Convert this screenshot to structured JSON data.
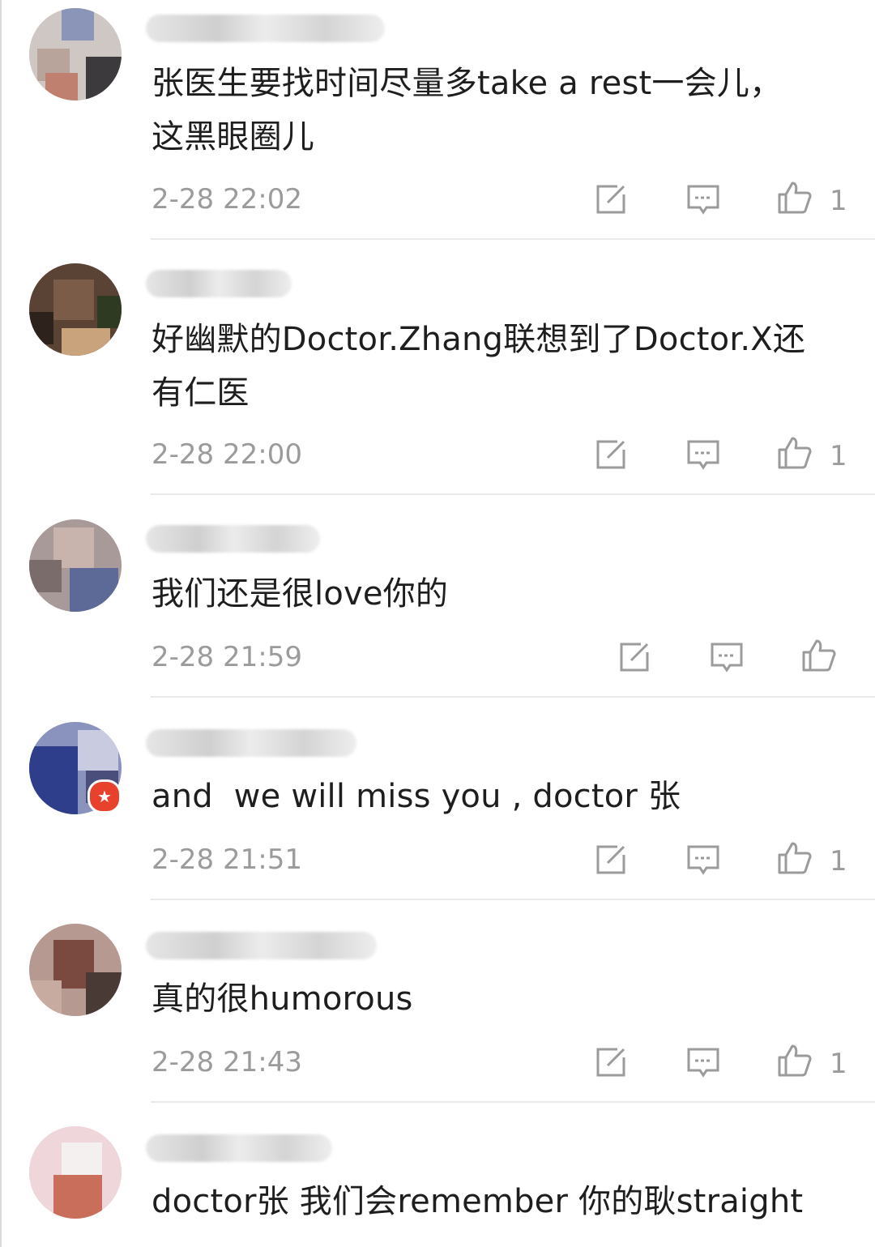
{
  "comments": [
    {
      "text": "张医生要找时间尽量多take a rest一会儿，\n这黑眼圈儿",
      "time": "2-28 22:02",
      "likes": "1"
    },
    {
      "text": "好幽默的Doctor.Zhang联想到了Doctor.X还\n有仁医",
      "time": "2-28 22:00",
      "likes": "1"
    },
    {
      "text": "我们还是很love你的",
      "time": "2-28 21:59",
      "likes": ""
    },
    {
      "text": "and  we will miss you , doctor 张",
      "time": "2-28 21:51",
      "likes": "1",
      "badge_icon": "star-badge-icon"
    },
    {
      "text": "真的很humorous",
      "time": "2-28 21:43",
      "likes": "1"
    },
    {
      "text": "doctor张 我们会remember 你的耿straight",
      "time": "",
      "likes": ""
    }
  ],
  "icons": {
    "share": "share-edit-icon",
    "reply": "comment-icon",
    "like": "thumbs-up-icon"
  },
  "colors": {
    "text": "#1e1e1e",
    "meta": "#9b9b9b",
    "divider": "#e9e9e9",
    "badge": "#e8412c"
  }
}
